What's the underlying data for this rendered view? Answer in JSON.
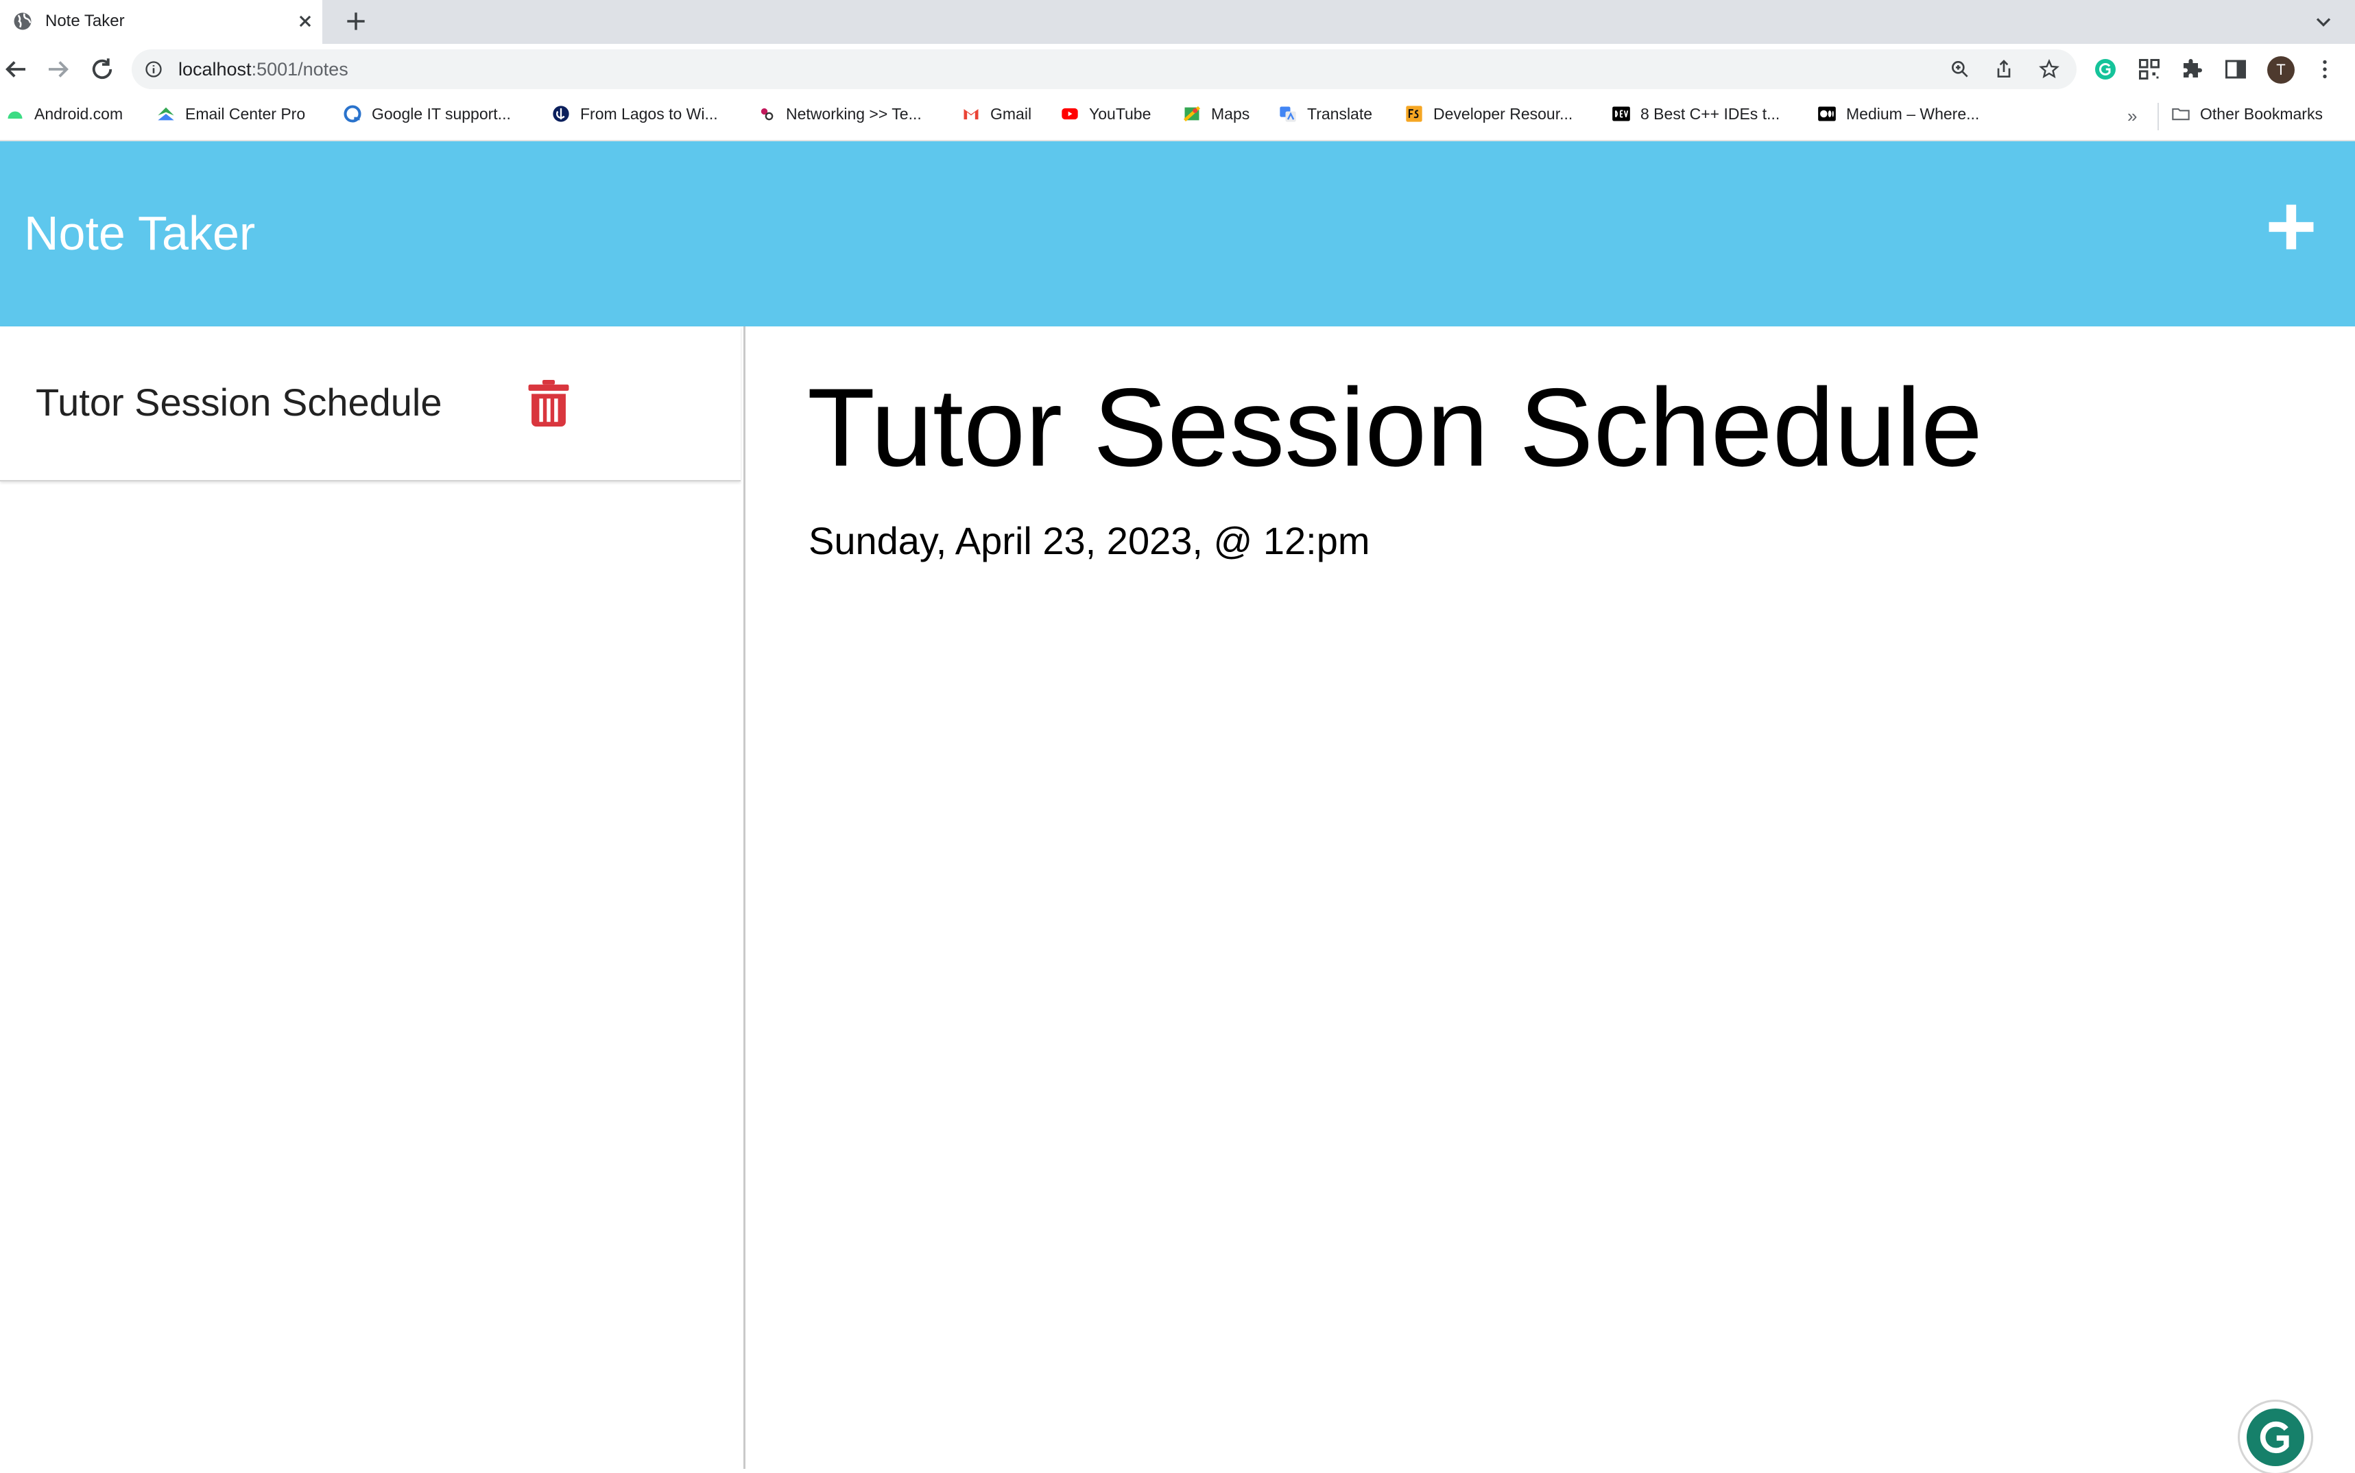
{
  "browser": {
    "tab": {
      "title": "Note Taker"
    },
    "url": {
      "host": "localhost",
      "path": ":5001/notes"
    },
    "profile_initial": "T",
    "bookmarks": [
      {
        "label": "Android.com",
        "icon": "android-icon",
        "color": "#3ddc84"
      },
      {
        "label": "Email Center Pro",
        "icon": "email-center-icon",
        "color": "#34a853"
      },
      {
        "label": "Google IT support...",
        "icon": "coursera-icon",
        "color": "#2a73cc"
      },
      {
        "label": "From Lagos to Wi...",
        "icon": "site-icon",
        "color": "#0b1f5c"
      },
      {
        "label": "Networking >> Te...",
        "icon": "networking-icon",
        "color": "#c2185b"
      },
      {
        "label": "Gmail",
        "icon": "gmail-icon",
        "color": "#ea4335"
      },
      {
        "label": "YouTube",
        "icon": "youtube-icon",
        "color": "#ff0000"
      },
      {
        "label": "Maps",
        "icon": "maps-icon",
        "color": "#34a853"
      },
      {
        "label": "Translate",
        "icon": "translate-icon",
        "color": "#4285f4"
      },
      {
        "label": "Developer Resour...",
        "icon": "fs-icon",
        "color": "#f5a623"
      },
      {
        "label": "8 Best C++ IDEs t...",
        "icon": "dev-icon",
        "color": "#000000"
      },
      {
        "label": "Medium – Where...",
        "icon": "medium-icon",
        "color": "#000000"
      }
    ],
    "bookmarks_overflow": "»",
    "other_bookmarks": "Other Bookmarks"
  },
  "app": {
    "title": "Note Taker",
    "accent_color": "#5ec7ed",
    "delete_color": "#d9363e",
    "sidebar": {
      "notes": [
        {
          "title": "Tutor Session Schedule"
        }
      ]
    },
    "active_note": {
      "title": "Tutor Session Schedule",
      "text": "Sunday, April 23, 2023, @ 12:pm"
    }
  }
}
